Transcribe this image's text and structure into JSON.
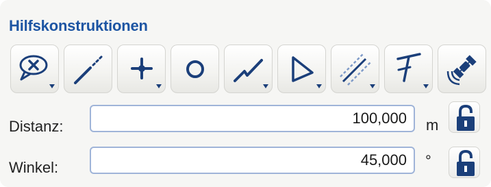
{
  "panel": {
    "title": "Hilfskonstruktionen"
  },
  "toolbar": {
    "tools": [
      {
        "icon": "cancel-selection-icon",
        "has_dropdown": true
      },
      {
        "icon": "dashed-line-icon",
        "has_dropdown": false
      },
      {
        "icon": "point-icon",
        "has_dropdown": true
      },
      {
        "icon": "circle-icon",
        "has_dropdown": false
      },
      {
        "icon": "polyline-icon",
        "has_dropdown": true
      },
      {
        "icon": "triangle-icon",
        "has_dropdown": true
      },
      {
        "icon": "parallel-lines-icon",
        "has_dropdown": true
      },
      {
        "icon": "perpendicular-icon",
        "has_dropdown": true
      },
      {
        "icon": "satellite-icon",
        "has_dropdown": false
      }
    ]
  },
  "distance": {
    "label": "Distanz:",
    "value": "100,000",
    "unit": "m",
    "lock_icon": "unlocked-padlock-icon"
  },
  "angle": {
    "label": "Winkel:",
    "value": "45,000",
    "unit": "°",
    "lock_icon": "unlocked-padlock-icon"
  },
  "colors": {
    "title": "#1d55a3",
    "icon": "#1b3f7a",
    "field_border": "#9fb4d8"
  }
}
